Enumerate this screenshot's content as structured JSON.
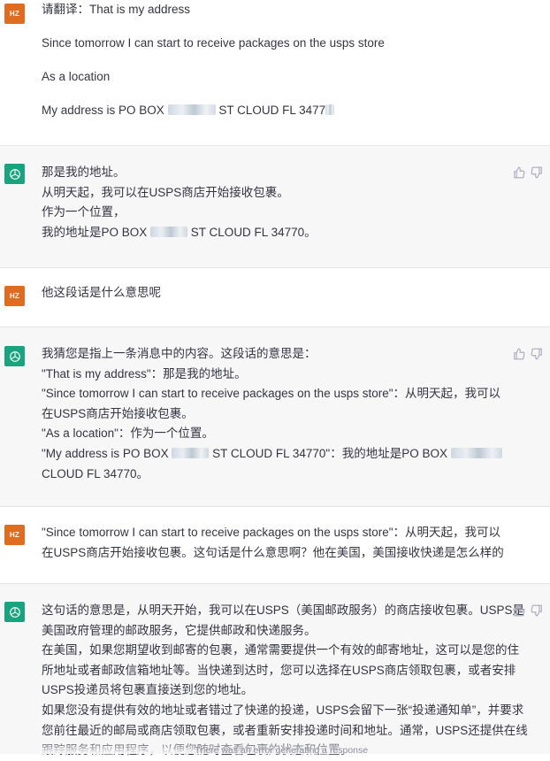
{
  "avatar_user_text": "HZ",
  "messages": [
    {
      "role": "user",
      "lines": [
        "请翻译：That is my address",
        "Since tomorrow I can start to receive packages on the usps store",
        "As a location",
        "My address is PO BOX ",
        "ST CLOUD FL 3477"
      ]
    },
    {
      "role": "assistant",
      "lines": [
        "那是我的地址。",
        "从明天起，我可以在USPS商店开始接收包裹。",
        "作为一个位置，",
        "我的地址是PO BOX ",
        "ST CLOUD FL 34770。"
      ]
    },
    {
      "role": "user",
      "lines": [
        "他这段话是什么意思呢"
      ]
    },
    {
      "role": "assistant",
      "lines": [
        "我猜您是指上一条消息中的内容。这段话的意思是：",
        "\"That is my address\"：那是我的地址。",
        "\"Since tomorrow I can start to receive packages on the usps store\"：从明天起，我可以",
        "在USPS商店开始接收包裹。",
        "\"As a location\"：作为一个位置。",
        "\"My address is PO BOX ",
        "ST CLOUD FL 34770\"：我的地址是PO BOX ",
        "CLOUD FL 34770。"
      ]
    },
    {
      "role": "user",
      "lines": [
        "\"Since tomorrow I can start to receive packages on the usps store\"：从明天起，我可以",
        "在USPS商店开始接收包裹。这句话是什么意思啊？他在美国，美国接收快递是怎么样的"
      ]
    },
    {
      "role": "assistant",
      "lines": [
        "这句话的意思是，从明天开始，我可以在USPS（美国邮政服务）的商店接收包裹。USPS是",
        "美国政府管理的邮政服务，它提供邮政和快递服务。",
        "在美国，如果您期望收到邮寄的包裹，通常需要提供一个有效的邮寄地址，这可以是您的住",
        "所地址或者邮政信箱地址等。当快递到达时，您可以选择在USPS商店领取包裹，或者安排",
        "USPS投递员将包裹直接送到您的地址。",
        "如果您没有提供有效的地址或者错过了快递的投递，USPS会留下一张“投递通知单”，并要求",
        "您前往最近的邮局或商店领取包裹，或者重新安排投递时间和地址。通常，USPS还提供在线",
        "跟踪服务和应用程序，以便您随时查看包裹的状态和位置。"
      ]
    }
  ],
  "status": {
    "error_text": "There was an error generating a response"
  },
  "colors": {
    "user_avatar": "#e06c1f",
    "assistant_avatar": "#19a37f",
    "assistant_background": "#f7f7f8"
  }
}
